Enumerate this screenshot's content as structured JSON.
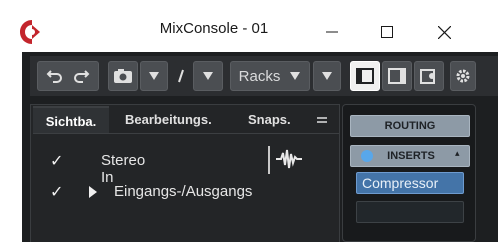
{
  "window": {
    "title": "MixConsole - 01",
    "controls": [
      "minimize",
      "maximize",
      "close"
    ]
  },
  "toolbar": {
    "racks_label": "Racks"
  },
  "left_panel": {
    "tabs": [
      "Sichtba.",
      "Bearbeitungs.",
      "Snaps."
    ],
    "menu_icon": "hamburger-icon",
    "rows": [
      {
        "checked": true,
        "label": "Stereo In"
      },
      {
        "checked": true,
        "label": "Eingangs-/Ausgangs"
      }
    ]
  },
  "right_panel": {
    "routing_label": "ROUTING",
    "inserts_label": "INSERTS",
    "insert_slots": [
      "Compressor",
      ""
    ]
  },
  "colors": {
    "accent": "#4474a8",
    "logo": "#c3252c",
    "power": "#58a7ea"
  }
}
